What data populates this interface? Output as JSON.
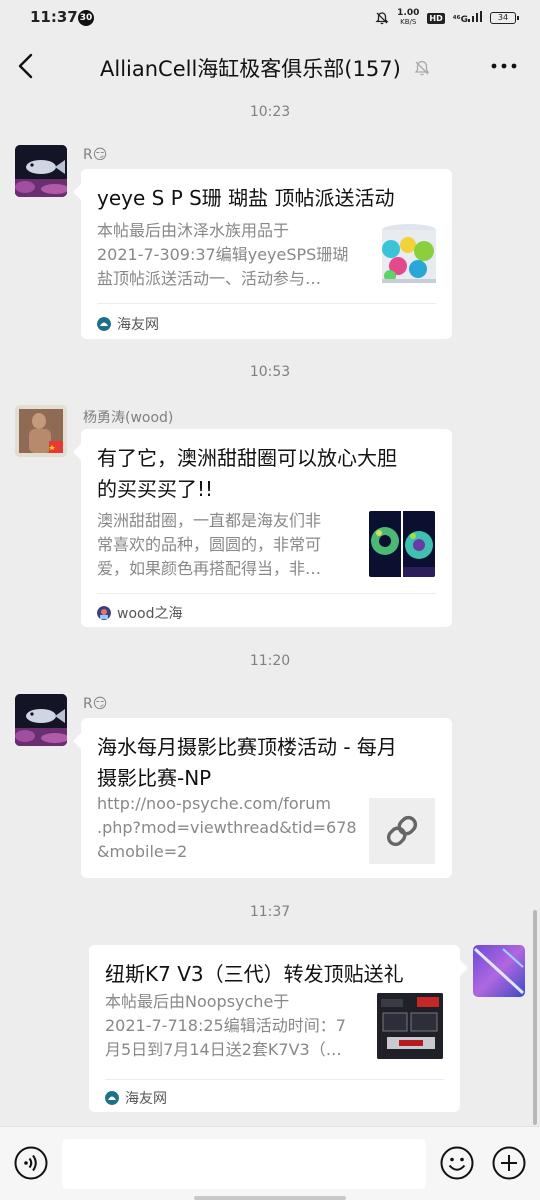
{
  "status_bar": {
    "time": "11:37",
    "notif_count": "30",
    "net_speed": "1.00",
    "net_unit": "KB/S",
    "hd": "HD",
    "signal": "⁴⁶G",
    "battery": "34"
  },
  "header": {
    "title": "AllianCell海缸极客俱乐部(157)"
  },
  "messages": [
    {
      "time": "10:23",
      "sender": "R😏",
      "title": "yeye S P S珊 瑚盐 顶帖派送活动",
      "desc_lines": [
        "本帖最后由沐泽水族用品于",
        "2021-7-309:37编辑yeyeSPS珊瑚",
        "盐顶帖派送活动一、活动参与…"
      ],
      "source": "海友网"
    },
    {
      "time": "10:53",
      "sender": "杨勇涛(wood)",
      "title_lines": [
        "有了它，澳洲甜甜圈可以放心大胆",
        "的买买买了!!"
      ],
      "desc_lines": [
        "澳洲甜甜圈，一直都是海友们非",
        "常喜欢的品种，圆圆的，非常可",
        "爱，如果颜色再搭配得当，非…"
      ],
      "source": "wood之海"
    },
    {
      "time": "11:20",
      "sender": "R😏",
      "title_lines": [
        "海水每月摄影比赛顶楼活动 - 每月",
        "摄影比赛-NP"
      ],
      "desc_lines": [
        "http://noo-psyche.com/forum",
        ".php?mod=viewthread&tid=678",
        "&mobile=2"
      ]
    },
    {
      "time": "11:37",
      "title": "纽斯K7 V3（三代）转发顶贴送礼",
      "desc_lines": [
        "本帖最后由Noopsyche于",
        "2021-7-718:25编辑活动时间：7",
        "月5日到7月14日送2套K7V3（…"
      ],
      "source": "海友网"
    }
  ],
  "colors": {
    "background": "#ededed",
    "bubble": "#ffffff",
    "muted_text": "#808080"
  }
}
